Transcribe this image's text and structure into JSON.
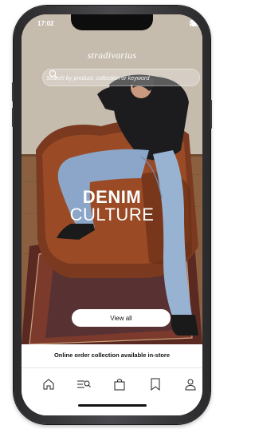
{
  "status_bar": {
    "time": "17:02",
    "icons": [
      "signal-icon",
      "wifi-icon",
      "battery-icon"
    ]
  },
  "brand": {
    "logo": "stradivarius"
  },
  "search": {
    "placeholder": "Search by product, collection or keyword"
  },
  "hero": {
    "headline_line1": "DENIM",
    "headline_line2": "CULTURE",
    "cta_label": "View all"
  },
  "banner": {
    "text": "Online order collection available in-store"
  },
  "tab_bar": {
    "items": [
      "home-icon",
      "search-menu-icon",
      "bag-icon",
      "wishlist-icon",
      "account-icon"
    ]
  },
  "colors": {
    "accent": "#111111",
    "screen_bg": "#ffffff"
  }
}
